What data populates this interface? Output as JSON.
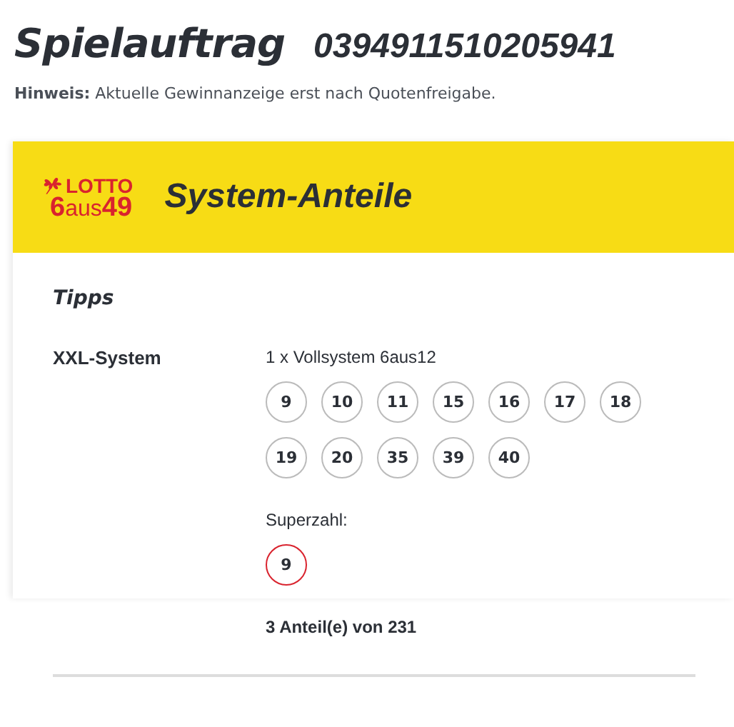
{
  "heading": {
    "title": "Spielauftrag",
    "number": "0394911510205941"
  },
  "notice": "**Hinweis:** Aktuelle Gewinnanzeige erst nach Quotenfreigabe.",
  "card": {
    "logo": {
      "top": "LOTTO",
      "bottom": "**6**aus**49**"
    },
    "title": "System-Anteile",
    "section": "Tipps",
    "tip": {
      "label": "XXL-System",
      "system": "1 x Vollsystem 6aus12",
      "balls": [
        {
          "kind": "number",
          "value": "9"
        },
        {
          "kind": "number",
          "value": "10"
        },
        {
          "kind": "number",
          "value": "11"
        },
        {
          "kind": "number",
          "value": "15"
        },
        {
          "kind": "number",
          "value": "16"
        },
        {
          "kind": "number",
          "value": "17"
        },
        {
          "kind": "number",
          "value": "18"
        },
        {
          "kind": "number",
          "value": "19"
        },
        {
          "kind": "number",
          "value": "20"
        },
        {
          "kind": "number",
          "value": "35"
        },
        {
          "kind": "number",
          "value": "39"
        },
        {
          "kind": "number",
          "value": "40"
        }
      ],
      "superzahl_label": "Superzahl:",
      "superzahl": [
        {
          "kind": "superzahl",
          "value": "9"
        }
      ],
      "shares": "3 Anteil(e) von 231"
    }
  }
}
